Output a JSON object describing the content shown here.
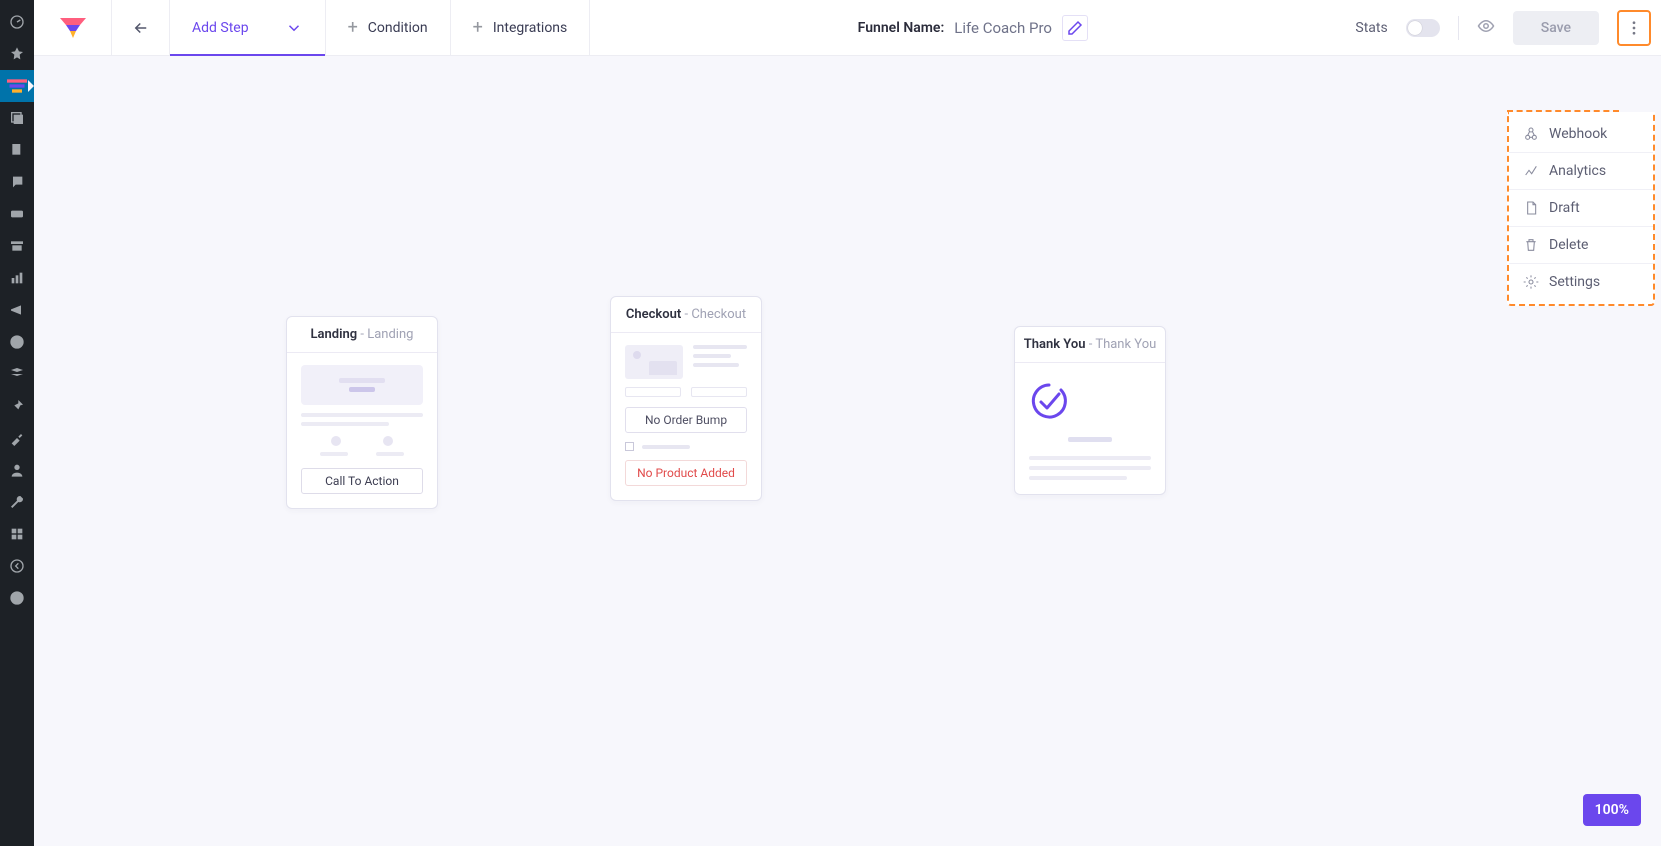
{
  "toolbar": {
    "add_step": "Add Step",
    "condition": "Condition",
    "integrations": "Integrations",
    "funnel_name_label": "Funnel Name:",
    "funnel_name": "Life Coach Pro",
    "stats_label": "Stats",
    "save_label": "Save"
  },
  "dropdown": {
    "items": [
      {
        "label": "Webhook"
      },
      {
        "label": "Analytics"
      },
      {
        "label": "Draft"
      },
      {
        "label": "Delete"
      },
      {
        "label": "Settings"
      }
    ]
  },
  "steps": {
    "landing": {
      "name": "Landing",
      "type": "Landing",
      "cta": "Call To Action"
    },
    "checkout": {
      "name": "Checkout",
      "type": "Checkout",
      "no_bump": "No Order Bump",
      "no_product": "No Product Added"
    },
    "thankyou": {
      "name": "Thank You",
      "type": "Thank You"
    }
  },
  "zoom": "100%",
  "colors": {
    "accent": "#6b47ed",
    "highlight": "#ff8a2b",
    "danger": "#e14a4a"
  }
}
